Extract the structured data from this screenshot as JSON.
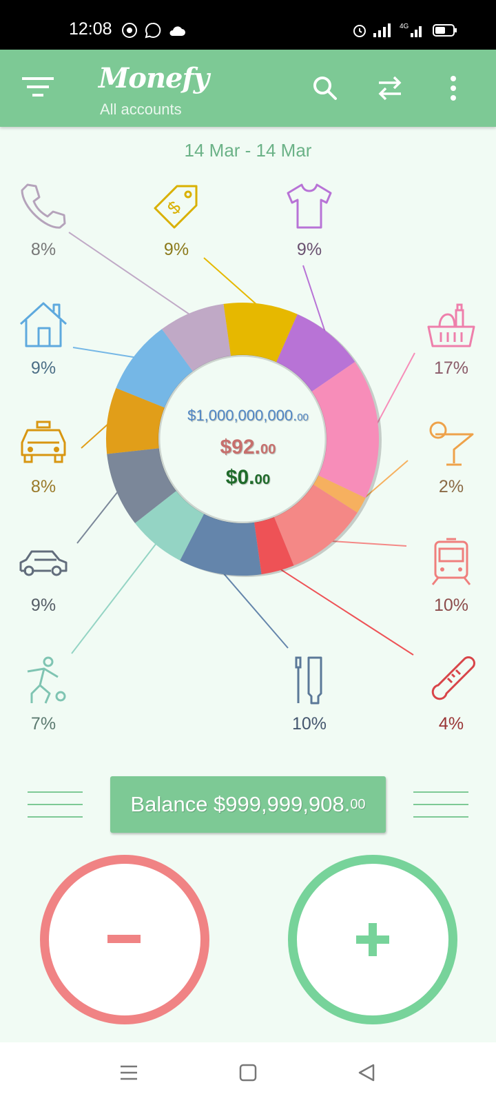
{
  "status_bar": {
    "time": "12:08"
  },
  "app_bar": {
    "title": "Monefy",
    "subtitle": "All accounts",
    "icons": [
      "menu-filter-icon",
      "search-icon",
      "transfer-icon",
      "more-vert-icon"
    ]
  },
  "date_range": "14 Mar - 14 Mar",
  "summary": {
    "total_main": "$1,000,000,000.",
    "total_cents": "00",
    "expense_main": "$92.",
    "expense_cents": "00",
    "income_main": "$0.",
    "income_cents": "00"
  },
  "categories": [
    {
      "name": "phone",
      "icon": "phone-icon",
      "percent": "8%",
      "color": "#c0a9c6",
      "text_color": "#777777"
    },
    {
      "name": "clothes",
      "icon": "tshirt-icon",
      "percent": "9%",
      "color": "#b873d6",
      "text_color": "#6a5170"
    },
    {
      "name": "groceries",
      "icon": "grocery-basket-icon",
      "percent": "17%",
      "color": "#f78db9",
      "text_color": "#8a5a68"
    },
    {
      "name": "drinks",
      "icon": "cocktail-icon",
      "percent": "2%",
      "color": "#f6b05f",
      "text_color": "#8a6a45"
    },
    {
      "name": "transport",
      "icon": "train-icon",
      "percent": "10%",
      "color": "#f48886",
      "text_color": "#8c4c4b"
    },
    {
      "name": "health",
      "icon": "thermometer-icon",
      "percent": "4%",
      "color": "#ee5256",
      "text_color": "#9a3535"
    },
    {
      "name": "toiletries",
      "icon": "toothbrush-icon",
      "percent": "10%",
      "color": "#6485ab",
      "text_color": "#44566e"
    },
    {
      "name": "sports",
      "icon": "soccer-player-icon",
      "percent": "7%",
      "color": "#94d4c4",
      "text_color": "#5c7a70"
    },
    {
      "name": "car",
      "icon": "car-icon",
      "percent": "9%",
      "color": "#7b8799",
      "text_color": "#555d66"
    },
    {
      "name": "taxi",
      "icon": "taxi-icon",
      "percent": "8%",
      "color": "#e19e19",
      "text_color": "#9a7a2a"
    },
    {
      "name": "house",
      "icon": "house-icon",
      "percent": "9%",
      "color": "#75b7e6",
      "text_color": "#4b6e86"
    },
    {
      "name": "gifts",
      "icon": "price-tag-icon",
      "percent": "9%",
      "color": "#e6b800",
      "text_color": "#8c7a1c"
    }
  ],
  "balance": {
    "label": "Balance $999,999,908.",
    "cents": "00"
  },
  "buttons": {
    "expense_icon": "minus-icon",
    "income_icon": "plus-icon"
  },
  "nav_bar": {
    "icons": [
      "recent-apps-icon",
      "home-icon",
      "back-icon"
    ]
  }
}
